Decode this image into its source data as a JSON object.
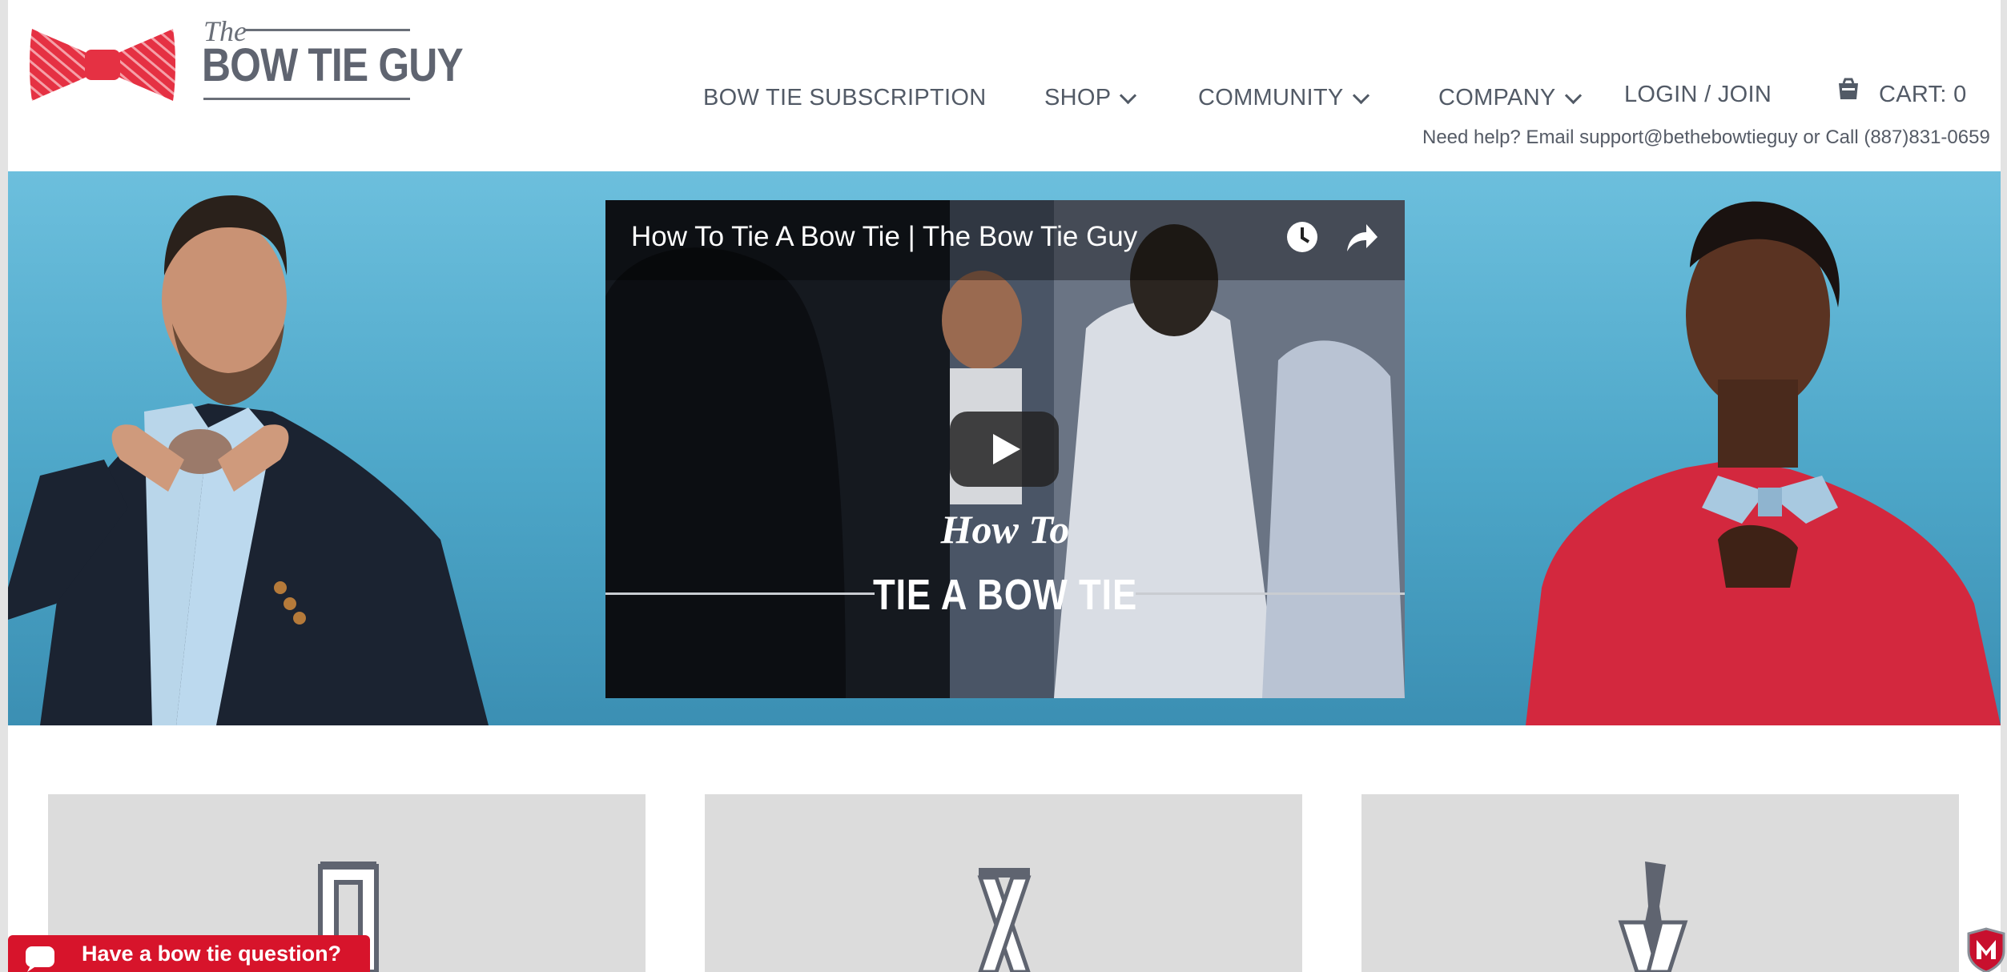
{
  "logo": {
    "the": "The",
    "name": "BOW TIE GUY"
  },
  "nav": {
    "subscription": "BOW TIE SUBSCRIPTION",
    "shop": "SHOP",
    "community": "COMMUNITY",
    "company": "COMPANY",
    "login": "LOGIN / JOIN",
    "cart": "CART: 0"
  },
  "help_text": "Need help? Email support@bethebowtieguy or Call (887)831-0659",
  "video": {
    "title": "How To Tie A Bow Tie | The Bow Tie Guy",
    "overlay_line1": "How To",
    "overlay_line2": "TIE A BOW TIE"
  },
  "chat": {
    "label": "Have a bow tie question?"
  },
  "icons": {
    "logo": "bow-tie-icon",
    "cart": "cart-icon",
    "video_clock": "watch-later-icon",
    "video_share": "share-icon",
    "play": "play-icon",
    "chat": "chat-bubble-icon",
    "security": "mcafee-icon",
    "step1": "tie-step-1-icon",
    "step2": "tie-step-2-icon",
    "step3": "tie-step-3-icon"
  },
  "colors": {
    "brand_red": "#e53143",
    "text_gray": "#555b66",
    "hero_blue": "#4da6c8",
    "card_gray": "#dcdcdc",
    "chat_red": "#d7142b"
  }
}
